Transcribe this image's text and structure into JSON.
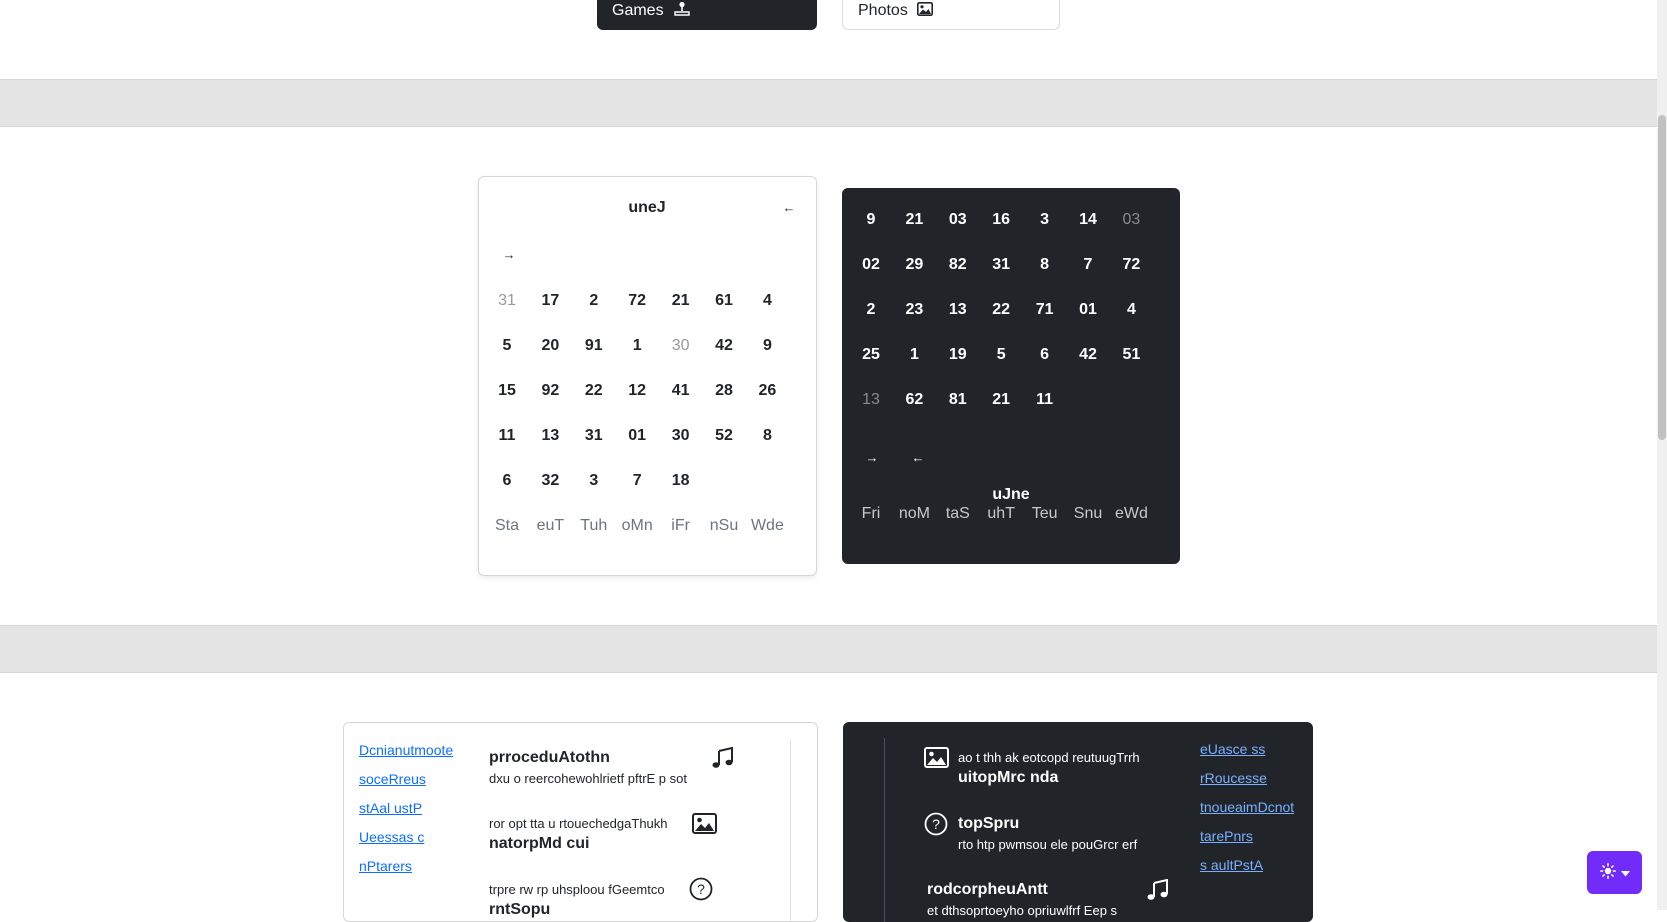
{
  "top_tabs": {
    "games": "Games",
    "photos": "Photos"
  },
  "cal_light": {
    "month": "uneJ",
    "prev_arrow": "←",
    "next_arrow": "→",
    "weekdays": [
      "Sta",
      "euT",
      "Tuh",
      "oMn",
      "iFr",
      "nSu",
      "Wde"
    ],
    "rows": [
      [
        "31",
        "17",
        "2",
        "72",
        "21",
        "61",
        "4"
      ],
      [
        "5",
        "20",
        "91",
        "1",
        "30",
        "42",
        "9"
      ],
      [
        "15",
        "92",
        "22",
        "12",
        "41",
        "28",
        "26"
      ],
      [
        "11",
        "13",
        "31",
        "01",
        "30",
        "52",
        "8"
      ],
      [
        "6",
        "32",
        "3",
        "7",
        "18",
        "",
        ""
      ]
    ]
  },
  "cal_dark": {
    "month": "uJne",
    "prev_arrow": "←",
    "next_arrow": "→",
    "weekdays": [
      "Fri",
      "noM",
      "taS",
      "uhT",
      "Teu",
      "Snu",
      "eWd"
    ],
    "rows": [
      [
        "9",
        "21",
        "03",
        "16",
        "3",
        "14",
        "03"
      ],
      [
        "02",
        "29",
        "82",
        "31",
        "8",
        "7",
        "72"
      ],
      [
        "2",
        "23",
        "13",
        "22",
        "71",
        "01",
        "4"
      ],
      [
        "25",
        "1",
        "19",
        "5",
        "6",
        "42",
        "51"
      ],
      [
        "13",
        "62",
        "81",
        "21",
        "11",
        "",
        ""
      ]
    ]
  },
  "feat_light": {
    "links": [
      "Dcnianutmoote",
      "soceRreus",
      "stAal ustP",
      "Ueessas c",
      "nPtarers"
    ],
    "items": [
      {
        "title": "prroceduAtothn",
        "text": "dxu o reercohewohlrietf pftrE p sot",
        "icon": "music-note-icon"
      },
      {
        "title": "natorpMd cui",
        "text": "ror opt tta u rtouechedgaThukh",
        "icon": "image-icon"
      },
      {
        "title": "rntSopu",
        "text": "trpre rw rp uhsploou fGeemtco",
        "icon": "question-circle-icon"
      }
    ]
  },
  "feat_dark": {
    "links": [
      "eUasce ss",
      "rRoucesse",
      "tnoueaimDcnot",
      "tarePnrs",
      "s aultPstA"
    ],
    "items": [
      {
        "title": "uitopMrc nda",
        "text": "ao t thh ak eotcopd reutuugTrrh",
        "icon": "image-icon"
      },
      {
        "title": "topSpru",
        "text": "rto htp pwmsou ele pouGrcr erf",
        "icon": "question-circle-icon"
      },
      {
        "title": "rodcorpheuAntt",
        "text": "et dthsoprtoeyho opriuwlfrf Eep s",
        "icon": "music-note-icon"
      }
    ]
  },
  "colors": {
    "accent": "#712cf9",
    "dark": "#212529",
    "link": "#0d6efd"
  }
}
